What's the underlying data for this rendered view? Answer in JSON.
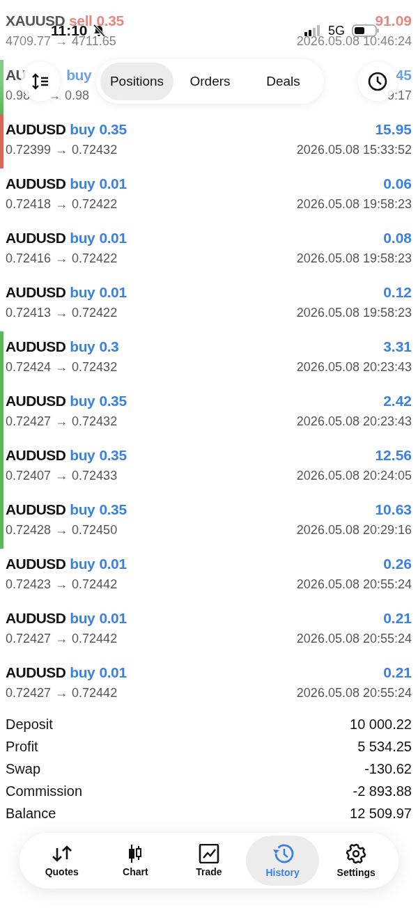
{
  "status_bar": {
    "time": "11:10",
    "network": "5G"
  },
  "top_bar": {
    "tabs": [
      {
        "label": "Positions",
        "selected": true
      },
      {
        "label": "Orders",
        "selected": false
      },
      {
        "label": "Deals",
        "selected": false
      }
    ]
  },
  "deals": [
    {
      "symbol": "XAUUSD",
      "side": "sell",
      "kind": "sell",
      "volume": "0.35",
      "profit": "91.09",
      "price_open": "4709.77",
      "price_close": "4711.65",
      "time": "2026.05.08 10:46:24"
    },
    {
      "symbol": "AU",
      "side": "buy",
      "kind": "buy",
      "profit": "45",
      "price_open": "0.98",
      "price_close": "0.98",
      "time": "9:17",
      "color": "#5cb85c",
      "partial": true
    },
    {
      "symbol": "AUDUSD",
      "side": "buy",
      "kind": "buy",
      "volume": "0.35",
      "profit": "15.95",
      "price_open": "0.72399",
      "price_close": "0.72432",
      "time": "2026.05.08 15:33:52",
      "color": "#d9685a"
    },
    {
      "symbol": "AUDUSD",
      "side": "buy",
      "kind": "buy",
      "volume": "0.01",
      "profit": "0.06",
      "price_open": "0.72418",
      "price_close": "0.72422",
      "time": "2026.05.08 19:58:23"
    },
    {
      "symbol": "AUDUSD",
      "side": "buy",
      "kind": "buy",
      "volume": "0.01",
      "profit": "0.08",
      "price_open": "0.72416",
      "price_close": "0.72422",
      "time": "2026.05.08 19:58:23"
    },
    {
      "symbol": "AUDUSD",
      "side": "buy",
      "kind": "buy",
      "volume": "0.01",
      "profit": "0.12",
      "price_open": "0.72413",
      "price_close": "0.72422",
      "time": "2026.05.08 19:58:23"
    },
    {
      "symbol": "AUDUSD",
      "side": "buy",
      "kind": "buy",
      "volume": "0.3",
      "profit": "3.31",
      "price_open": "0.72424",
      "price_close": "0.72432",
      "time": "2026.05.08 20:23:43",
      "color": "#5cb85c"
    },
    {
      "symbol": "AUDUSD",
      "side": "buy",
      "kind": "buy",
      "volume": "0.35",
      "profit": "2.42",
      "price_open": "0.72427",
      "price_close": "0.72432",
      "time": "2026.05.08 20:23:43",
      "color": "#5cb85c"
    },
    {
      "symbol": "AUDUSD",
      "side": "buy",
      "kind": "buy",
      "volume": "0.35",
      "profit": "12.56",
      "price_open": "0.72407",
      "price_close": "0.72433",
      "time": "2026.05.08 20:24:05",
      "color": "#5cb85c"
    },
    {
      "symbol": "AUDUSD",
      "side": "buy",
      "kind": "buy",
      "volume": "0.35",
      "profit": "10.63",
      "price_open": "0.72428",
      "price_close": "0.72450",
      "time": "2026.05.08 20:29:16",
      "color": "#5cb85c"
    },
    {
      "symbol": "AUDUSD",
      "side": "buy",
      "kind": "buy",
      "volume": "0.01",
      "profit": "0.26",
      "price_open": "0.72423",
      "price_close": "0.72442",
      "time": "2026.05.08 20:55:24"
    },
    {
      "symbol": "AUDUSD",
      "side": "buy",
      "kind": "buy",
      "volume": "0.01",
      "profit": "0.21",
      "price_open": "0.72427",
      "price_close": "0.72442",
      "time": "2026.05.08 20:55:24"
    },
    {
      "symbol": "AUDUSD",
      "side": "buy",
      "kind": "buy",
      "volume": "0.01",
      "profit": "0.21",
      "price_open": "0.72427",
      "price_close": "0.72442",
      "time": "2026.05.08 20:55:24"
    }
  ],
  "arrow": "→",
  "summary": [
    {
      "label": "Deposit",
      "value": "10 000.22"
    },
    {
      "label": "Profit",
      "value": "5 534.25"
    },
    {
      "label": "Swap",
      "value": "-130.62"
    },
    {
      "label": "Commission",
      "value": "-2 893.88"
    },
    {
      "label": "Balance",
      "value": "12 509.97"
    }
  ],
  "bottom_nav": [
    {
      "label": "Quotes",
      "selected": false
    },
    {
      "label": "Chart",
      "selected": false
    },
    {
      "label": "Trade",
      "selected": false
    },
    {
      "label": "History",
      "selected": true
    },
    {
      "label": "Settings",
      "selected": false
    }
  ]
}
